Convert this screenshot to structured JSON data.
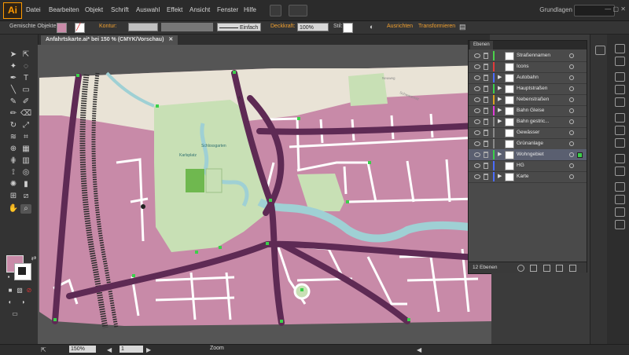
{
  "app": {
    "logo": "Ai"
  },
  "menu": [
    "Datei",
    "Bearbeiten",
    "Objekt",
    "Schrift",
    "Auswahl",
    "Effekt",
    "Ansicht",
    "Fenster",
    "Hilfe"
  ],
  "workspace": "Grundlagen",
  "control_bar": {
    "selection_label": "Gemischte Objekte",
    "stroke_label": "Kontur:",
    "stroke_style": "Einfach",
    "opacity_label": "Deckkraft:",
    "opacity_value": "100%",
    "style_label": "Stil:",
    "align_label": "Ausrichten",
    "transform_label": "Transformieren"
  },
  "document_tab": "Anfahrtskarte.ai* bei 150 % (CMYK/Vorschau)",
  "map_labels": [
    "Schlossgarten",
    "Karlsplatz",
    "Neuweg",
    "Schwanenstr"
  ],
  "layers_panel": {
    "tab": "Ebenen",
    "layers": [
      {
        "name": "Straßennamen",
        "color": "#4bd24b",
        "arrow": "",
        "selected": false
      },
      {
        "name": "Icons",
        "color": "#e23b3b",
        "arrow": "",
        "selected": false
      },
      {
        "name": "Autobahn",
        "color": "#4b6cff",
        "arrow": "▶",
        "selected": false
      },
      {
        "name": "Hauptstraßen",
        "color": "#3bd04a",
        "arrow": "▶",
        "selected": false
      },
      {
        "name": "Nebenstraßen",
        "color": "#d8a020",
        "arrow": "▶",
        "selected": false
      },
      {
        "name": "Bahn Gleise",
        "color": "#e03bd8",
        "arrow": "▶",
        "selected": false
      },
      {
        "name": "Bahn gestric...",
        "color": "#8a8a8a",
        "arrow": "▶",
        "selected": false
      },
      {
        "name": "Gewässer",
        "color": "#8a8a8a",
        "arrow": "",
        "selected": false
      },
      {
        "name": "Grünanlage",
        "color": "#8a8a8a",
        "arrow": "",
        "selected": false
      },
      {
        "name": "Wohngebiet",
        "color": "#3bd04a",
        "arrow": "▶",
        "selected": true
      },
      {
        "name": "HG",
        "color": "#4b6cff",
        "arrow": "",
        "selected": false
      },
      {
        "name": "Karte",
        "color": "#4b6cff",
        "arrow": "▶",
        "selected": false
      }
    ],
    "count": "12 Ebenen"
  },
  "status_bar": {
    "zoom": "150%",
    "page": "1",
    "mode": "Zoom"
  },
  "colors": {
    "residential": "#c88aa8",
    "park": "#c8e0b5",
    "water": "#9fd0d4",
    "road_major": "#5e2a54",
    "road_minor": "#ffffff",
    "rail": "#2a2a2a",
    "selection": "#3bd04a"
  }
}
